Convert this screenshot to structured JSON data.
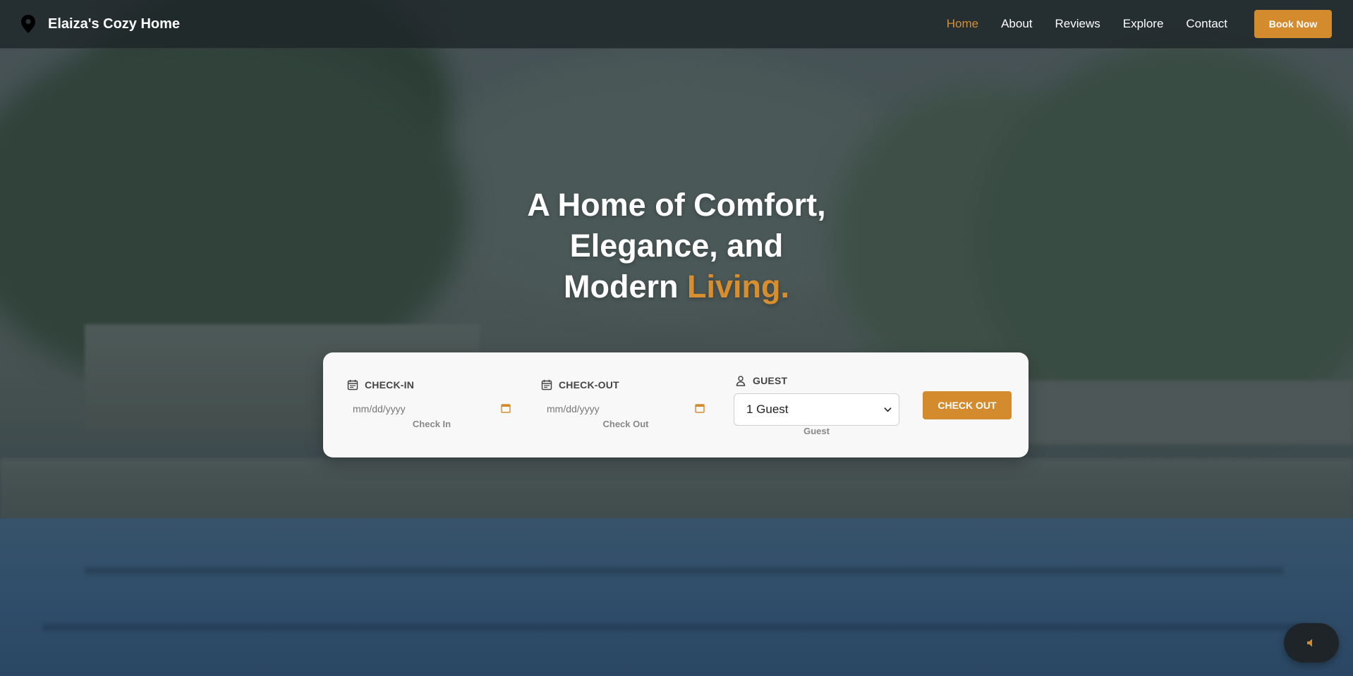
{
  "brand": {
    "name": "Elaiza's Cozy Home",
    "icon": "map-pin-icon"
  },
  "nav": {
    "links": [
      {
        "label": "Home",
        "active": true
      },
      {
        "label": "About",
        "active": false
      },
      {
        "label": "Reviews",
        "active": false
      },
      {
        "label": "Explore",
        "active": false
      },
      {
        "label": "Contact",
        "active": false
      }
    ],
    "cta_label": "Book Now"
  },
  "hero": {
    "line1": "A Home of Comfort,",
    "line2": "Elegance, and",
    "line3_prefix": "Modern ",
    "line3_accent": "Living."
  },
  "booking": {
    "checkin": {
      "label": "CHECK-IN",
      "placeholder": "mm/dd/yyyy",
      "sub": "Check In",
      "icon": "calendar-icon"
    },
    "checkout": {
      "label": "CHECK-OUT",
      "placeholder": "mm/dd/yyyy",
      "sub": "Check Out",
      "icon": "calendar-icon"
    },
    "guest": {
      "label": "GUEST",
      "selected": "1 Guest",
      "sub": "Guest",
      "icon": "user-icon"
    },
    "submit_label": "CHECK OUT"
  },
  "sound_toggle": {
    "icon": "speaker-icon"
  },
  "colors": {
    "accent": "#d38b2e",
    "nav_bg": "#1e2628",
    "card_bg": "#f8f8f8"
  }
}
